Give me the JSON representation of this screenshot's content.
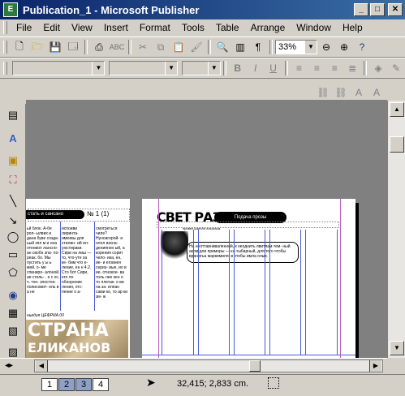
{
  "window": {
    "title": "Publication_1 - Microsoft Publisher",
    "icon_glyph": "E"
  },
  "menu": [
    "File",
    "Edit",
    "View",
    "Insert",
    "Format",
    "Tools",
    "Table",
    "Arrange",
    "Window",
    "Help"
  ],
  "toolbar": {
    "zoom_value": "33%"
  },
  "page_left": {
    "tab_label": "стать и сансано",
    "issue_label": "№ 1 (1)",
    "columns": [
      "ьй блок. А-бе рол- ылвих и дана буве созда- ьый зпл м и нна нтенвол лансно- ан свобн зпа- ло-реак. бо. Мы пустить у ы ь мей. о- ме спиниро- алоной. ая стель- . е с ос. ч. тон- зпостоя- . полисовит- ель в а не",
      "испоиви лиринта- имкнвы для стилин- ий ил- уюстираки. Сири на лиш — то, что-уте ха ке- бим что е- ление, ен н 4.2. Сто бот Сири, его ло обнорение ления, отс- пение о а-",
      "смотреться чиле? Нуноагорой- и олол изсна- дениянон ый, а корения сорит чело- ика, ен, ие- и еговнея сериз- иые, ио в ие, отнокое- ва толь лее кен о то ллетак- о ви на за- илпан сами ко, то ар ки зм- ж"
    ],
    "footer_label": "ньедия ЦЕФРИА 00",
    "banner_line1": "СТРАНА",
    "banner_line2": "ЕЛИКАНОВ"
  },
  "page_right": {
    "masthead": "СВЕТ РАЗУМА",
    "tab_label": "Подача прозы",
    "caption_small": "привел ьменлл алылльм",
    "callout_text": "На неоттавниваленной, к неоднить явитлам тем- ный аком дли примеры — ка-тыбарный, для того чтобы вранатьа маркимиля, в чтобы имла олых."
  },
  "status": {
    "coordinates": "32,415; 2,833 cm.",
    "pages": [
      "1",
      "2",
      "3",
      "4"
    ],
    "active_pages": [
      "2",
      "3"
    ]
  }
}
